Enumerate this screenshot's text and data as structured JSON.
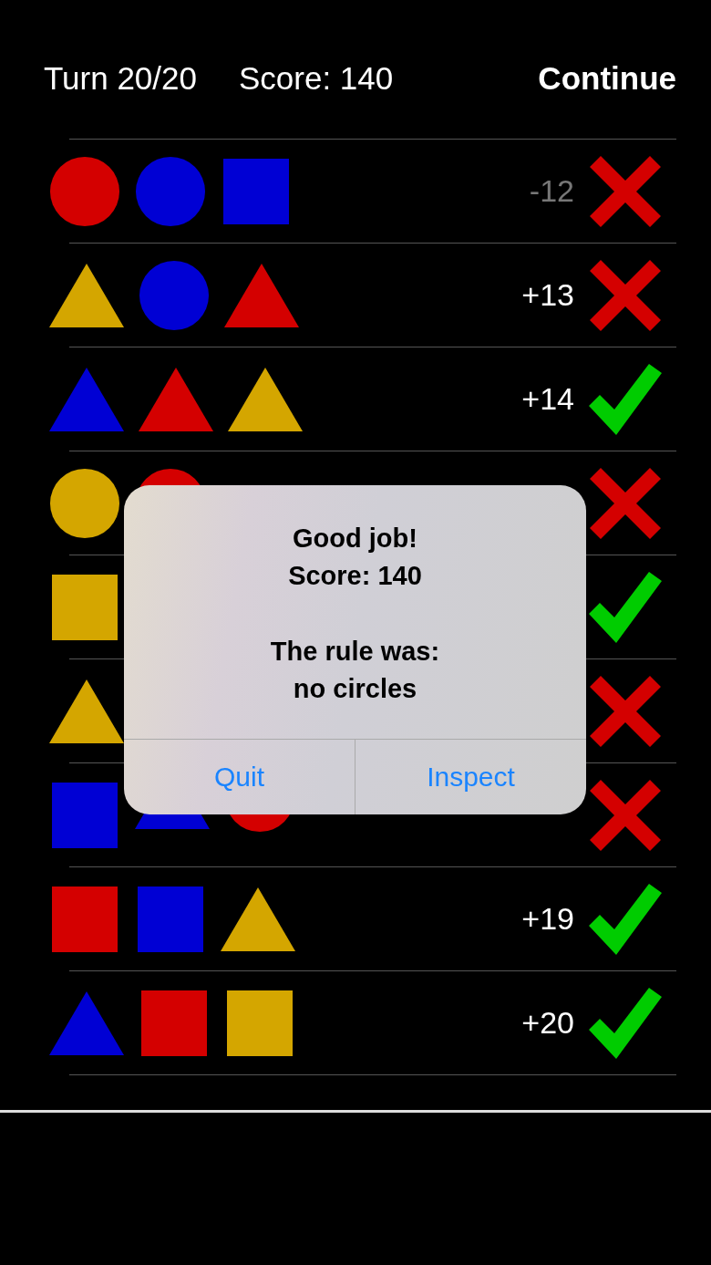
{
  "header": {
    "turn": "Turn 20/20",
    "score": "Score: 140",
    "action": "Continue"
  },
  "rows": [
    {
      "shapes": [
        {
          "kind": "circle",
          "color": "#d40000"
        },
        {
          "kind": "circle",
          "color": "#0000d4"
        },
        {
          "kind": "square",
          "color": "#0000d4"
        }
      ],
      "points": "-12",
      "dimmed": true,
      "correct": false
    },
    {
      "shapes": [
        {
          "kind": "triangle",
          "color": "#d4a600"
        },
        {
          "kind": "circle",
          "color": "#0000d4"
        },
        {
          "kind": "triangle",
          "color": "#d40000"
        }
      ],
      "points": "+13",
      "dimmed": false,
      "correct": false
    },
    {
      "shapes": [
        {
          "kind": "triangle",
          "color": "#0000d4"
        },
        {
          "kind": "triangle",
          "color": "#d40000"
        },
        {
          "kind": "triangle",
          "color": "#d4a600"
        }
      ],
      "points": "+14",
      "dimmed": false,
      "correct": true
    },
    {
      "shapes": [
        {
          "kind": "circle",
          "color": "#d4a600"
        },
        {
          "kind": "circle",
          "color": "#d40000"
        }
      ],
      "correct": false
    },
    {
      "shapes": [
        {
          "kind": "square",
          "color": "#d4a600"
        }
      ],
      "correct": true
    },
    {
      "shapes": [
        {
          "kind": "triangle",
          "color": "#d4a600"
        }
      ],
      "correct": false
    },
    {
      "shapes": [
        {
          "kind": "square",
          "color": "#0000d4"
        },
        {
          "kind": "triangle",
          "color": "#0000d4"
        },
        {
          "kind": "circle",
          "color": "#d40000"
        }
      ],
      "correct": false
    },
    {
      "shapes": [
        {
          "kind": "square",
          "color": "#d40000"
        },
        {
          "kind": "square",
          "color": "#0000d4"
        },
        {
          "kind": "triangle",
          "color": "#d4a600"
        }
      ],
      "points": "+19",
      "dimmed": false,
      "correct": true
    },
    {
      "shapes": [
        {
          "kind": "triangle",
          "color": "#0000d4"
        },
        {
          "kind": "square",
          "color": "#d40000"
        },
        {
          "kind": "square",
          "color": "#d4a600"
        }
      ],
      "points": "+20",
      "dimmed": false,
      "correct": true
    }
  ],
  "dialog": {
    "title": "Good job!",
    "score": "Score: 140",
    "rule_label": "The rule was:",
    "rule": "no circles",
    "buttons": [
      "Quit",
      "Inspect"
    ]
  }
}
